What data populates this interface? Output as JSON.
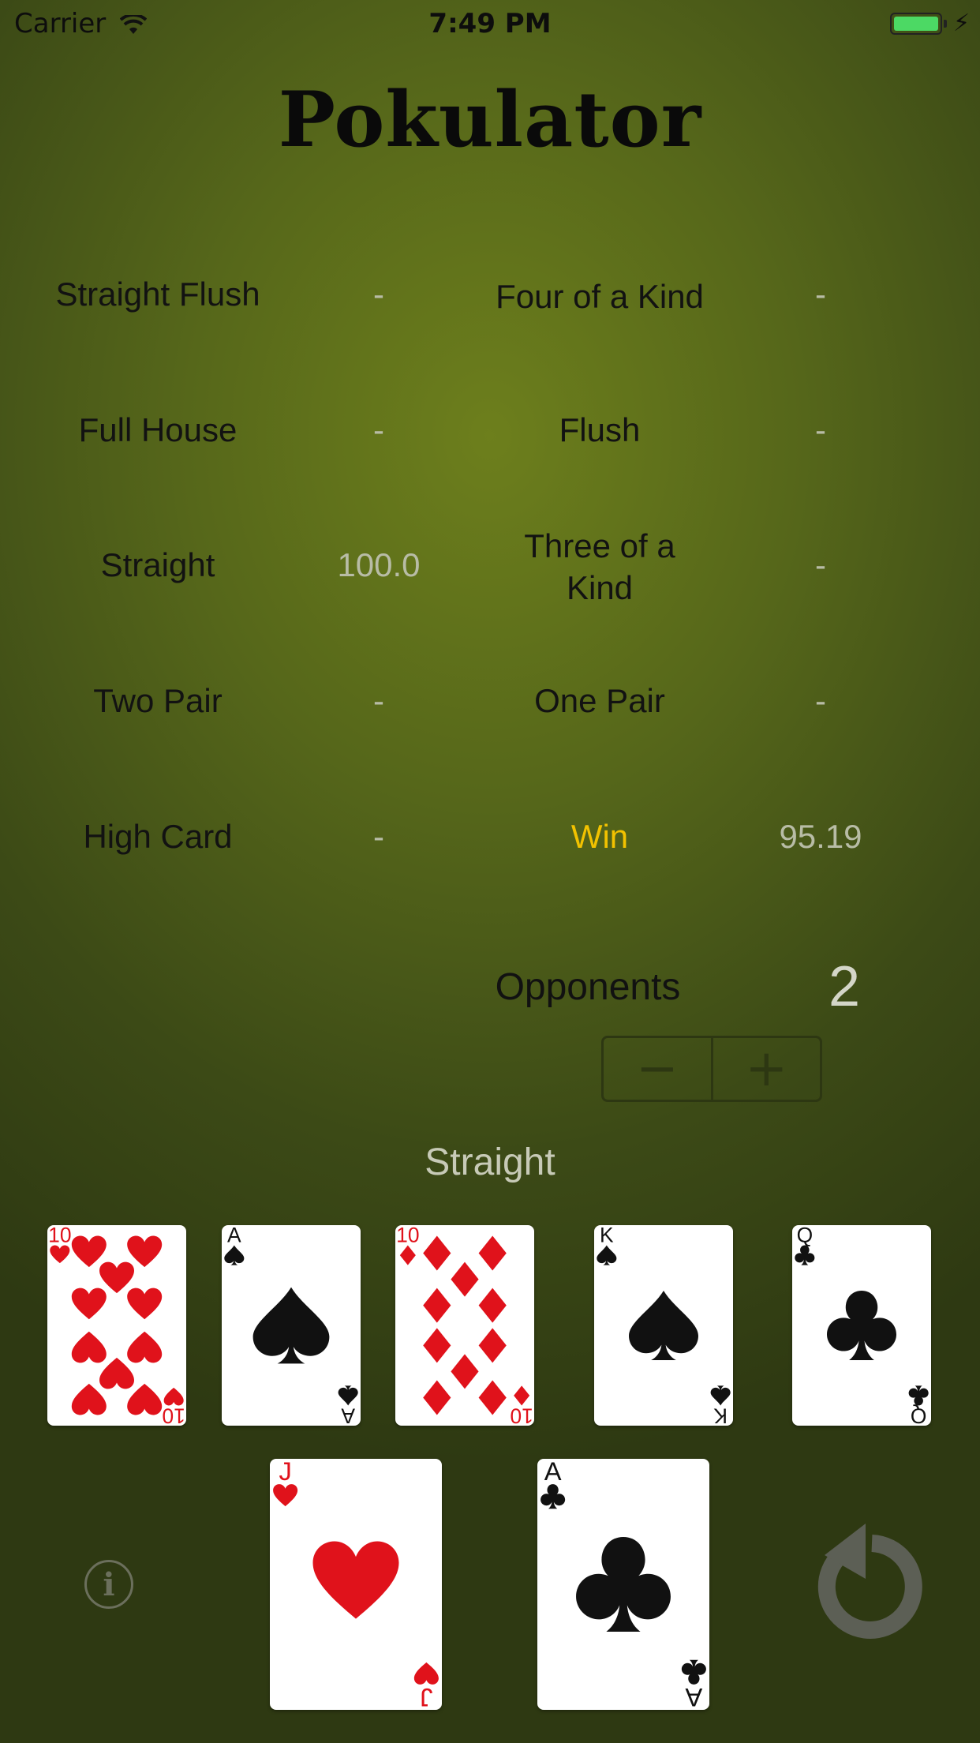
{
  "status_bar": {
    "carrier": "Carrier",
    "time": "7:49 PM",
    "battery_color": "#4cd964"
  },
  "app_title": "Pokulator",
  "odds": [
    {
      "label": "Straight Flush",
      "value": "-"
    },
    {
      "label": "Four of a Kind",
      "value": "-"
    },
    {
      "label": "Full House",
      "value": "-"
    },
    {
      "label": "Flush",
      "value": "-"
    },
    {
      "label": "Straight",
      "value": "100.0"
    },
    {
      "label": "Three of a Kind",
      "value": "-"
    },
    {
      "label": "Two Pair",
      "value": "-"
    },
    {
      "label": "One Pair",
      "value": "-"
    },
    {
      "label": "High Card",
      "value": "-"
    },
    {
      "label": "Win",
      "value": "95.19"
    }
  ],
  "opponents": {
    "label": "Opponents",
    "count": "2",
    "decrement": "−",
    "increment": "+"
  },
  "current_hand": "Straight",
  "board_cards": [
    {
      "rank": "10",
      "suit": "hearts"
    },
    {
      "rank": "A",
      "suit": "spades"
    },
    {
      "rank": "10",
      "suit": "diamonds"
    },
    {
      "rank": "K",
      "suit": "spades"
    },
    {
      "rank": "Q",
      "suit": "clubs"
    }
  ],
  "hole_cards": [
    {
      "rank": "J",
      "suit": "hearts"
    },
    {
      "rank": "A",
      "suit": "clubs"
    }
  ],
  "icons": {
    "info": "info-icon",
    "reset": "reset-icon"
  },
  "colors": {
    "felt": "#5a6b1b",
    "win_accent": "#f2c200",
    "red_suit": "#e0121b",
    "black_suit": "#111111"
  }
}
